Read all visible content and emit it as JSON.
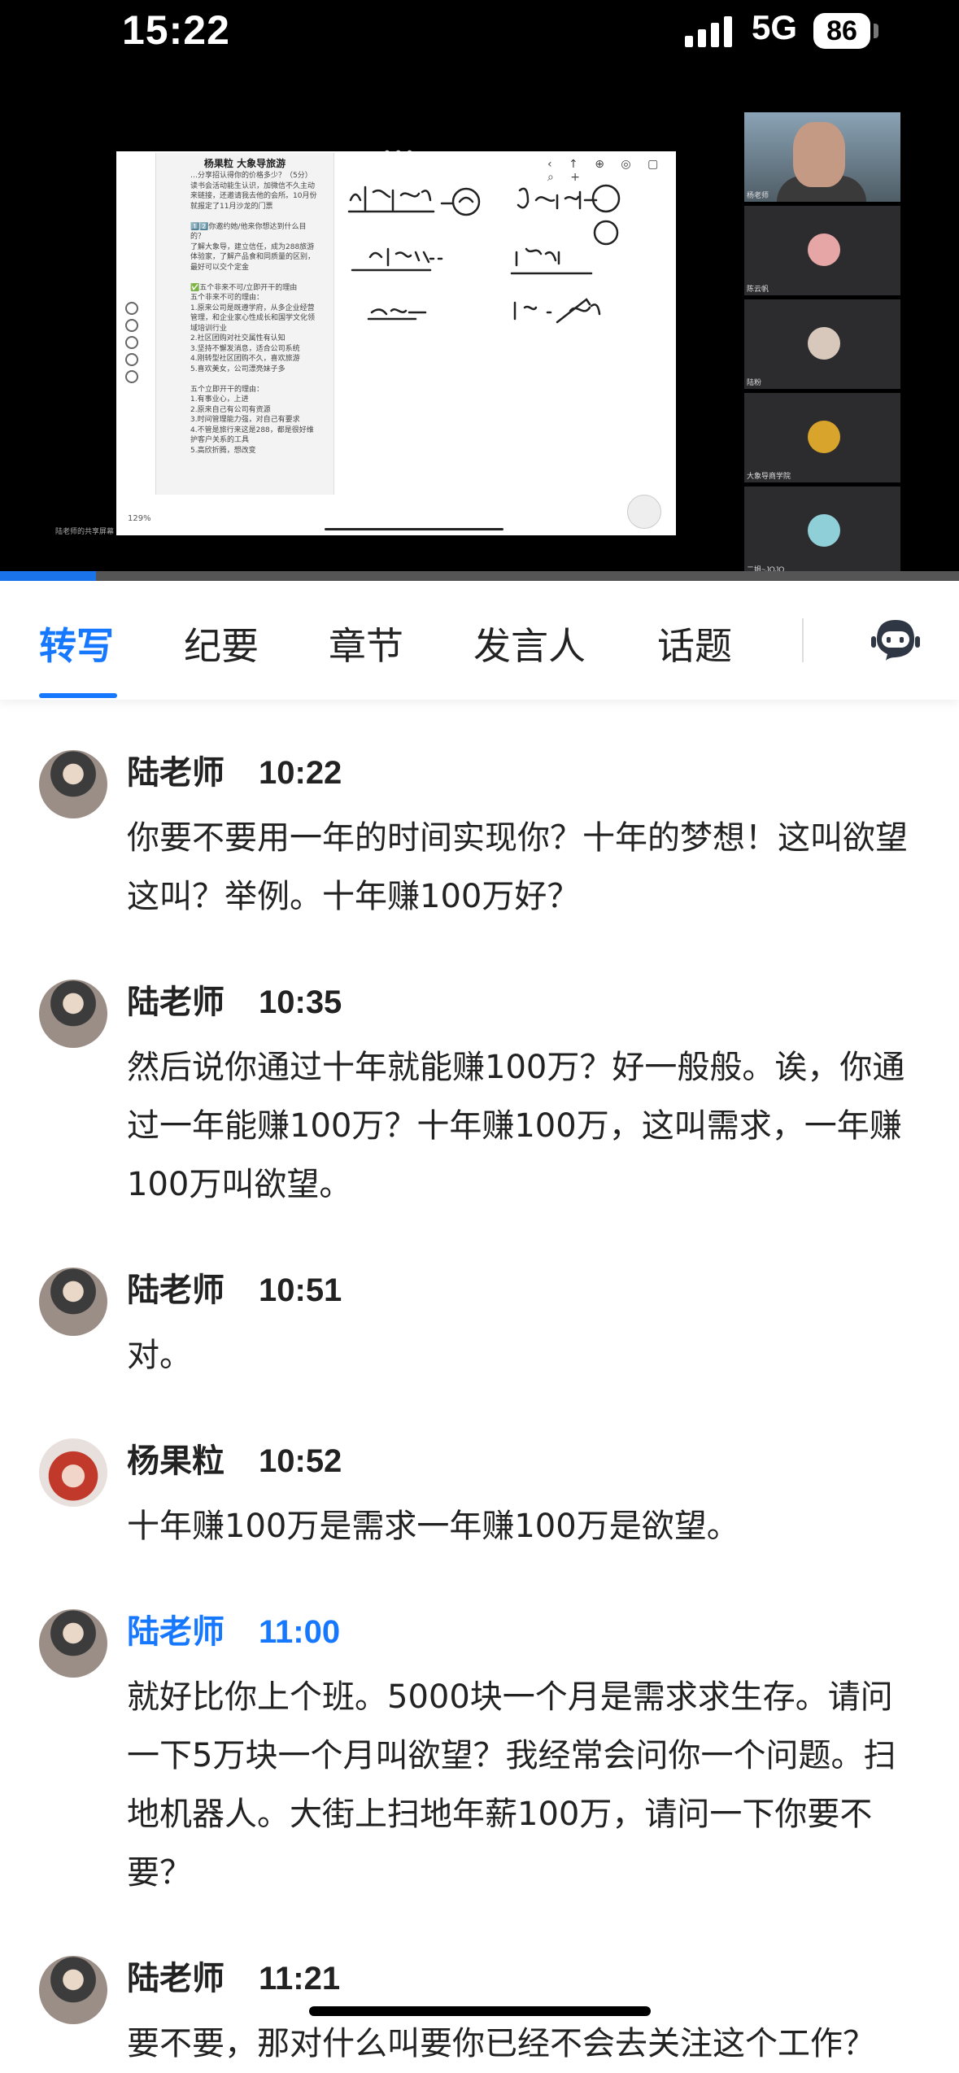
{
  "status_bar": {
    "time": "15:22",
    "network": "5G",
    "battery": "86"
  },
  "video": {
    "chat_panel_title": "杨果粒 大象导旅游",
    "chat_panel_text": "…分享招认得你的价格多少？（5分）\n读书会活动能生认识，加微信不久主动来链接，还邀请我去他的会所。10月份就报定了11月沙龙的门票\n\n1️⃣2️⃣你邀约她/他来你想达到什么目的？\n了解大象导，建立信任，成为288旅游体验家，了解产品食和同质量的区别，最好可以交个定金\n\n✅五个非来不可/立即开干的理由\n五个非来不可的理由：\n1.原来公司是既遵学府，从多企业经营管理，和企业家心性成长和国学文化领域培训行业\n2.社区团购对社交属性有认知\n3.坚持不懈发消息，适合公司系统\n4.刚转型社区团购不久，喜欢旅游\n5.喜欢美女，公司漂亮妹子多\n\n五个立即开干的理由：\n1.有事业心，上进\n2.原来自己有公司有资源\n3.时间管理能力强，对自己有要求\n4.不管是旅行来这是288，都是很好维护客户关系的工具\n5.高欣折腾，想改变",
    "zoom_level": "129%",
    "participants": [
      "杨老师",
      "陈云帆",
      "陆粉",
      "大象导商学院",
      "二姐~JOJO"
    ],
    "watermark": "陆老师的共享屏幕",
    "progress": 0.1
  },
  "tabs": [
    {
      "label": "转写",
      "active": true
    },
    {
      "label": "纪要",
      "active": false
    },
    {
      "label": "章节",
      "active": false
    },
    {
      "label": "发言人",
      "active": false
    },
    {
      "label": "话题",
      "active": false
    }
  ],
  "transcript": [
    {
      "speaker": "陆老师",
      "time": "10:22",
      "avatar": "teacher",
      "highlight": false,
      "text": "你要不要用一年的时间实现你？十年的梦想！这叫欲望这叫？举例。十年赚100万好？"
    },
    {
      "speaker": "陆老师",
      "time": "10:35",
      "avatar": "teacher",
      "highlight": false,
      "text": "然后说你通过十年就能赚100万？好一般般。诶，你通过一年能赚100万？十年赚100万，这叫需求，一年赚100万叫欲望。"
    },
    {
      "speaker": "陆老师",
      "time": "10:51",
      "avatar": "teacher",
      "highlight": false,
      "text": "对。"
    },
    {
      "speaker": "杨果粒",
      "time": "10:52",
      "avatar": "student",
      "highlight": false,
      "text": "十年赚100万是需求一年赚100万是欲望。"
    },
    {
      "speaker": "陆老师",
      "time": "11:00",
      "avatar": "teacher",
      "highlight": true,
      "text": "就好比你上个班。5000块一个月是需求求生存。请问一下5万块一个月叫欲望？我经常会问你一个问题。扫地机器人。大街上扫地年薪100万，请问一下你要不要？"
    },
    {
      "speaker": "陆老师",
      "time": "11:21",
      "avatar": "teacher",
      "highlight": false,
      "text": "要不要，那对什么叫要你已经不会去关注这个工作？"
    }
  ],
  "colors": {
    "accent": "#1677ff",
    "text": "#222222",
    "video_bg": "#000000"
  }
}
